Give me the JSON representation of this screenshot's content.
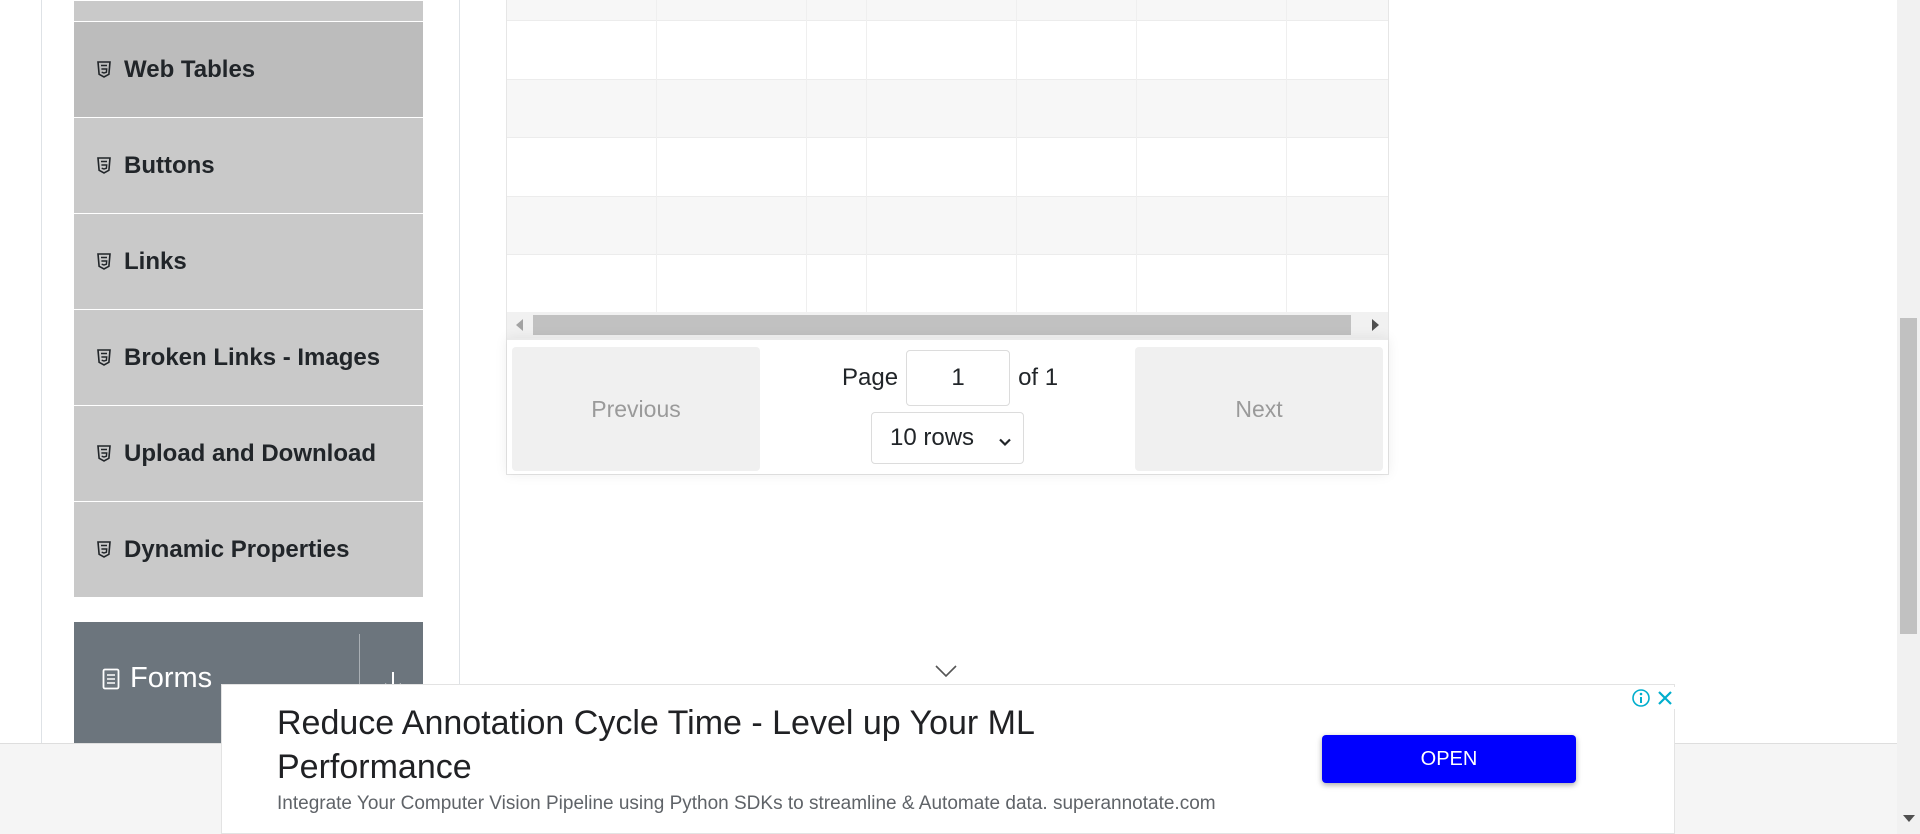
{
  "sidebar": {
    "items": [
      {
        "label": "Web Tables",
        "icon": "html5-icon"
      },
      {
        "label": "Buttons",
        "icon": "html5-icon"
      },
      {
        "label": "Links",
        "icon": "html5-icon"
      },
      {
        "label": "Broken Links - Images",
        "icon": "html5-icon"
      },
      {
        "label": "Upload and Download",
        "icon": "html5-icon"
      },
      {
        "label": "Dynamic Properties",
        "icon": "html5-icon"
      }
    ],
    "forms_group": {
      "label": "Forms",
      "icon": "document-icon",
      "toggle_icon": "arrow-down-icon"
    }
  },
  "pagination": {
    "previous_label": "Previous",
    "page_label": "Page",
    "current_page": "1",
    "of_label": "of 1",
    "rows_selected": "10 rows",
    "next_label": "Next"
  },
  "ad": {
    "title": "Reduce Annotation Cycle Time - Level up Your ML Performance",
    "description": "Integrate Your Computer Vision Pipeline using Python SDKs to streamline & Automate data. superannotate.com",
    "open_label": "OPEN",
    "accent_color": "#0000ff"
  }
}
